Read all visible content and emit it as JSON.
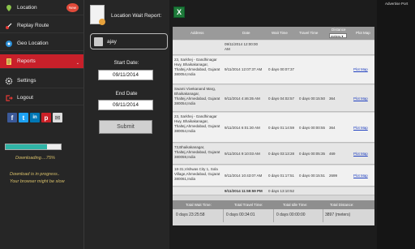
{
  "sidebar": {
    "items": [
      {
        "label": "Location",
        "badge": "New",
        "icon": "location-pin-icon"
      },
      {
        "label": "Replay Route",
        "icon": "route-icon"
      },
      {
        "label": "Geo Location",
        "icon": "geo-location-icon"
      },
      {
        "label": "Reports",
        "icon": "reports-icon",
        "active": true
      },
      {
        "label": "Settings",
        "icon": "gear-icon"
      },
      {
        "label": "Logout",
        "icon": "logout-icon"
      }
    ],
    "social": [
      "f",
      "t",
      "in",
      "p",
      "✉"
    ],
    "progress": {
      "value": 0.75,
      "label": "Downloading....75%"
    },
    "warning_line1": "Download is in progress..",
    "warning_line2": "Your browser might be slow"
  },
  "report": {
    "title": "Location Wait Report:",
    "user": "ajay",
    "start_label": "Start Date:",
    "start_value": "09/11/2014",
    "end_label": "End Date",
    "end_value": "09/11/2014",
    "submit_label": "Submit"
  },
  "ad": {
    "label": "Advertise Port"
  },
  "table": {
    "headers": [
      "Address",
      "Date",
      "Wait Time",
      "Travel Time",
      "Distance",
      "Plot Map"
    ],
    "distance_unit": "meters",
    "first_date": "09/11/2014 12:00:00 AM",
    "rows": [
      {
        "address": "23, Sarkhej - Gandhinagar Hwy, Bhaikakanagar, Thaltej,Ahmedabad, Gujarat 380054,India",
        "date": "9/11/2014 12:07:37 AM",
        "wait": "0 days 00:07:37",
        "travel": "",
        "distance": "",
        "map": "Plot Map"
      },
      {
        "address": "Swami Vivekanand Marg, Bhaikakanagar, Thaltej,Ahmedabad, Gujarat 380054,India",
        "date": "9/11/2014 4:46:35 AM",
        "wait": "0 days 04:02:57",
        "travel": "0 days 00:15:50",
        "distance": "364",
        "map": "Plot Map"
      },
      {
        "address": "23, Sarkhej - Gandhinagar Hwy, Bhaikakanagar, Thaltej,Ahmedabad, Gujarat 380054,India",
        "date": "9/11/2014 6:01:30 AM",
        "wait": "0 days 01:14:59",
        "travel": "0 days 00:00:55",
        "distance": "364",
        "map": "Plot Map"
      },
      {
        "address": "73,Bhaikakanagar, Thaltej,Ahmedabad, Gujarat 380059,India",
        "date": "9/11/2014 9:10:03 AM",
        "wait": "0 days 03:13:28",
        "travel": "0 days 00:05:35",
        "distance": "469",
        "map": "Plot Map"
      },
      {
        "address": "18-31,Vishwas City 1, Sola Village,Ahmedabad, Gujarat 380061,India",
        "date": "9/11/2014 10:43:07 AM",
        "wait": "0 days 01:17:51",
        "travel": "0 days 00:15:51",
        "distance": "2699",
        "map": "Plot Map"
      }
    ],
    "last_date": "9/11/2014 11:59:59 PM",
    "last_wait": "0 days 13:10:52"
  },
  "summary": {
    "headers": [
      "Total Wait Time:",
      "Total Travel Time:",
      "Total Idle Time:",
      "Total Distance:"
    ],
    "values": [
      "0 days 23:25:58",
      "0 days 00:34:01",
      "0 days 00:00:00",
      "3897 (meters)"
    ]
  },
  "colors": {
    "active": "#c8202a",
    "accent": "#2fb4a6",
    "warning": "#d9c06a"
  }
}
